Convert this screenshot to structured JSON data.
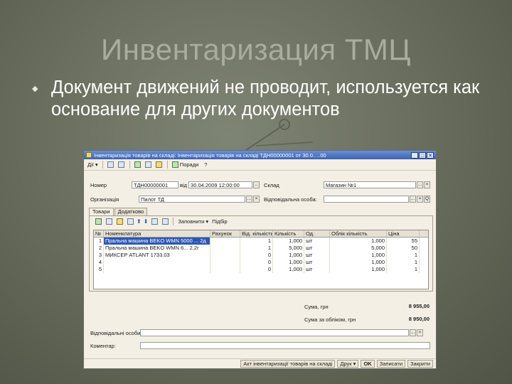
{
  "slide": {
    "title": "Инвентаризация ТМЦ",
    "bullet": "Документ движений не проводит, используется как основание для других документов"
  },
  "window": {
    "title": "Інвентаризація товарів на складі: Інвентаризація товарів на складі ТДН00000001 от 30.0.....00",
    "controls": [
      "_",
      "□",
      "✕"
    ]
  },
  "toolbar": {
    "actions_label": "Дії",
    "help_label": "Поради"
  },
  "form": {
    "number_label": "Номер",
    "number_value": "ТДН00000001",
    "date_label": "від",
    "date_value": "30.04.2009 12:00:00",
    "warehouse_label": "Склад",
    "warehouse_value": "Магазин №1",
    "org_label": "Організація",
    "org_value": "Пилот ТД",
    "responsible_label": "Відповідальна особа:",
    "responsible_value": "",
    "picker_symbol": "...",
    "clear_symbol": "×",
    "search_symbol": "Q"
  },
  "tabs": [
    {
      "label": "Товари"
    },
    {
      "label": "Додатково"
    }
  ],
  "grid_toolbar": {
    "fill_label": "Заповнити",
    "select_label": "Підбір"
  },
  "table": {
    "columns": [
      "№",
      "Номенклатура",
      "Рахунок",
      "Від. кількість",
      "Кількість",
      "Од.",
      "Облік кількість",
      "Ціна"
    ],
    "rows": [
      [
        "1",
        "Пральна машина BEKO WMN 5000 ... 2д",
        "",
        "1",
        "1,000",
        "шт",
        "1,000",
        "55"
      ],
      [
        "2",
        "Пральна машина BEKO WMN 6... 2,2г",
        "",
        "1",
        "5,000",
        "шт",
        "5,000",
        "50"
      ],
      [
        "3",
        "МИКСЕР ATLANT 1733.03",
        "",
        "0",
        "1,000",
        "шт",
        "1,000",
        "1"
      ],
      [
        "4",
        "",
        "",
        "0",
        "1,000",
        "шт",
        "1,000",
        "1"
      ],
      [
        "5",
        "",
        "",
        "0",
        "1,000",
        "шт",
        "1,000",
        "1"
      ]
    ]
  },
  "totals": {
    "sum_label": "Сума, грн",
    "sum_value": "8 955,00",
    "sum_accounted_label": "Сума за обліком, грн",
    "sum_accounted_value": "8 950,00"
  },
  "footer": {
    "responsible_label": "Відповідальні особи:",
    "comment_label": "Коментар:"
  },
  "bottom_buttons": {
    "report_label": "Акт інвентаризації товарів на складі",
    "print_label": "Друк",
    "ok_label": "OK",
    "save_label": "Записати",
    "close_label": "Закрити"
  }
}
